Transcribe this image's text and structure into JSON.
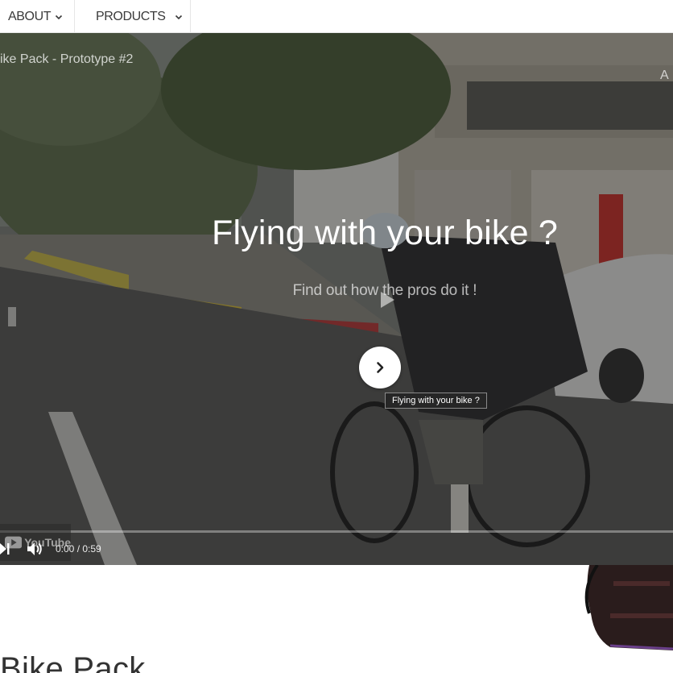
{
  "nav": {
    "items": [
      {
        "label": "ABOUT",
        "icon": "chevron-down-icon"
      },
      {
        "label": "PRODUCTS",
        "icon": "chevron-down-icon"
      }
    ]
  },
  "video": {
    "title": "ike Pack - Prototype #2",
    "title_right": "A",
    "headline": "Flying with your bike ?",
    "subline": "Find out how the pros do it !",
    "cta_icon": "chevron-right-icon",
    "tooltip": "Flying with your bike ?",
    "time_label": "0:00 / 0:59",
    "youtube_label": "YouTube",
    "progress": 0
  },
  "section": {
    "title": "Bike Pack"
  },
  "colors": {
    "nav_text": "#3a3a3a",
    "overlay": "#141414",
    "cta_bg": "#ffffff",
    "tooltip_bg": "#262626"
  }
}
